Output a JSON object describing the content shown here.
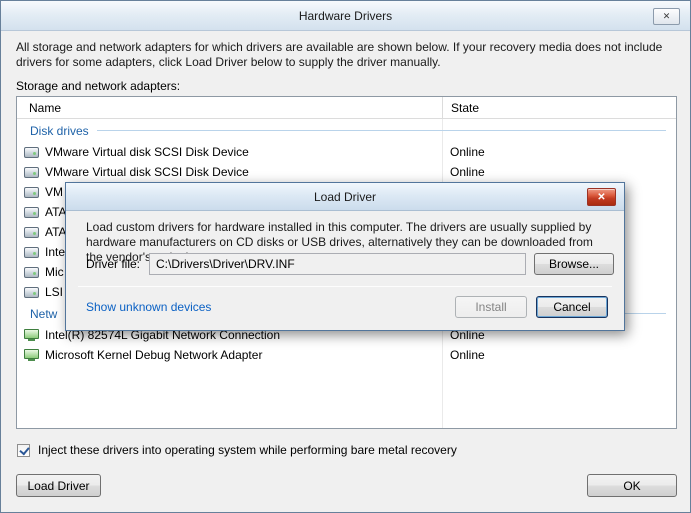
{
  "icons": {
    "close": "✕"
  },
  "colors": {
    "group_text": "#1E62A8",
    "link": "#0B61C4",
    "close_red": "#C23B22"
  },
  "window": {
    "title": "Hardware Drivers",
    "description": "All storage and network adapters for which drivers are available are shown below. If your recovery media does not include drivers for some adapters, click Load Driver below to supply the driver manually.",
    "adapters_label": "Storage and network adapters:",
    "table": {
      "columns": [
        "Name",
        "State"
      ],
      "groups": [
        {
          "label": "Disk drives",
          "rows": [
            {
              "icon": "disk",
              "name": "VMware Virtual disk SCSI Disk Device",
              "state": "Online"
            },
            {
              "icon": "disk",
              "name": "VMware Virtual disk SCSI Disk Device",
              "state": "Online"
            },
            {
              "icon": "disk",
              "name": "VM",
              "state": ""
            },
            {
              "icon": "disk",
              "name": "ATA",
              "state": ""
            },
            {
              "icon": "disk",
              "name": "ATA",
              "state": ""
            },
            {
              "icon": "disk",
              "name": "Inte",
              "state": ""
            },
            {
              "icon": "disk",
              "name": "Mic",
              "state": ""
            },
            {
              "icon": "disk",
              "name": "LSI",
              "state": ""
            }
          ]
        },
        {
          "label": "Netw",
          "rows": [
            {
              "icon": "network",
              "name": "Intel(R) 82574L Gigabit Network Connection",
              "state": "Online"
            },
            {
              "icon": "network",
              "name": "Microsoft Kernel Debug Network Adapter",
              "state": "Online"
            }
          ]
        }
      ]
    },
    "checkbox": {
      "label": "Inject these drivers into operating system while performing bare metal recovery",
      "checked": true
    },
    "buttons": {
      "load_driver": "Load Driver",
      "ok": "OK"
    }
  },
  "modal": {
    "title": "Load Driver",
    "description": "Load custom drivers for hardware installed in this computer. The drivers are usually supplied by hardware manufacturers on CD disks or USB drives, alternatively they can be downloaded from the vendor's web site.",
    "driver_file_label": "Driver file:",
    "driver_file_value": "C:\\Drivers\\Driver\\DRV.INF",
    "browse_label": "Browse...",
    "link": "Show unknown devices",
    "install_label": "Install",
    "cancel_label": "Cancel"
  }
}
